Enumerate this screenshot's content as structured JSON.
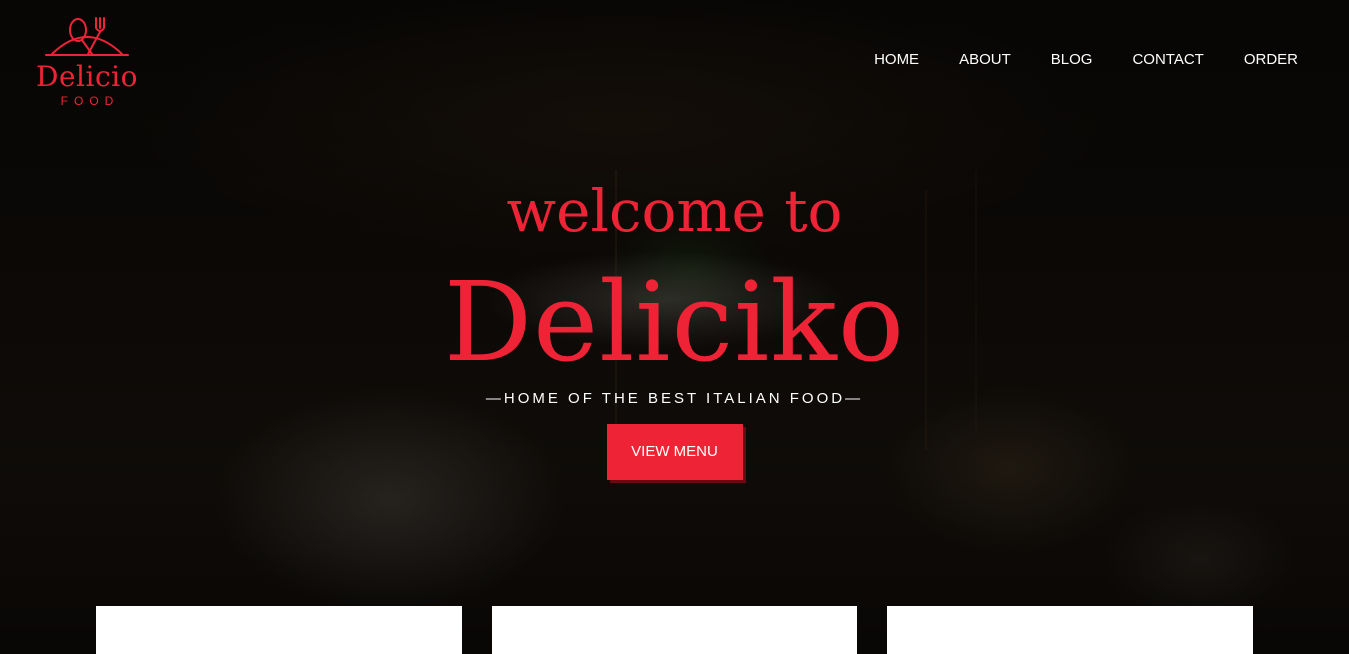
{
  "logo": {
    "name": "Delicio",
    "sub": "FOOD",
    "icon": "plate-cutlery-icon",
    "color": "#ee2436"
  },
  "nav": {
    "items": [
      {
        "label": "HOME"
      },
      {
        "label": "ABOUT"
      },
      {
        "label": "BLOG"
      },
      {
        "label": "CONTACT"
      },
      {
        "label": "ORDER"
      }
    ]
  },
  "hero": {
    "welcome": "welcome to",
    "brand": "Deliciko",
    "tagline": "—HOME OF THE BEST ITALIAN FOOD—",
    "button_label": "VIEW MENU",
    "accent_color": "#ee2436"
  }
}
